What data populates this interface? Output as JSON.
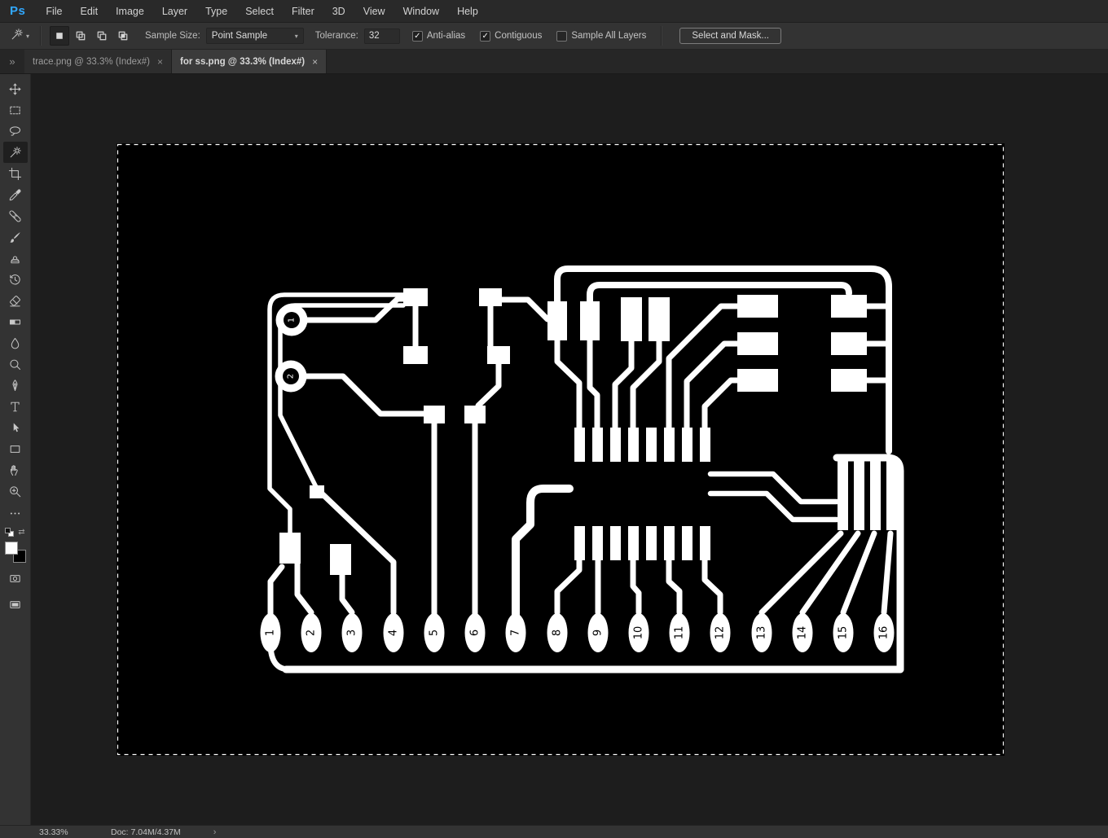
{
  "app": {
    "logo": "Ps"
  },
  "colors": {
    "logo_blue": "#31a8ff",
    "selection_white": "#ffffff",
    "canvas_black": "#000000"
  },
  "menubar": {
    "items": [
      "File",
      "Edit",
      "Image",
      "Layer",
      "Type",
      "Select",
      "Filter",
      "3D",
      "View",
      "Window",
      "Help"
    ]
  },
  "options_bar": {
    "selection_modes": [
      "new-selection",
      "add-to-selection",
      "subtract-from-selection",
      "intersect-selection"
    ],
    "active_selection_mode": "new-selection",
    "sample_size_label": "Sample Size:",
    "sample_size_value": "Point Sample",
    "tolerance_label": "Tolerance:",
    "tolerance_value": "32",
    "checkboxes": [
      {
        "label": "Anti-alias",
        "checked": true
      },
      {
        "label": "Contiguous",
        "checked": true
      },
      {
        "label": "Sample All Layers",
        "checked": false
      }
    ],
    "select_and_mask_label": "Select and Mask..."
  },
  "tab_bar": {
    "tabs": [
      {
        "label": "trace.png @ 33.3% (Index#)",
        "active": false
      },
      {
        "label": "for ss.png @ 33.3% (Index#)",
        "active": true
      }
    ]
  },
  "toolbar": {
    "tools": [
      "move",
      "rectangular-marquee",
      "lasso",
      "magic-wand",
      "crop",
      "eyedropper",
      "spot-healing-brush",
      "brush",
      "clone-stamp",
      "history-brush",
      "eraser",
      "gradient",
      "blur",
      "dodge",
      "pen",
      "type",
      "path-selection",
      "rectangle",
      "hand",
      "zoom",
      "more-tools"
    ],
    "selected_tool": "magic-wand"
  },
  "canvas": {
    "image": {
      "bottom_pad_labels": [
        "1",
        "2",
        "3",
        "4",
        "5",
        "6",
        "7",
        "8",
        "9",
        "10",
        "11",
        "12",
        "13",
        "14",
        "15",
        "16"
      ],
      "circle_pad_labels": [
        "1",
        "2"
      ]
    }
  },
  "status_bar": {
    "zoom": "33.33%",
    "doc_info": "Doc: 7.04M/4.37M"
  },
  "glyphs": {
    "caret": "▾",
    "close": "×",
    "collapse": "»",
    "chevron": "›",
    "check": "✓"
  }
}
